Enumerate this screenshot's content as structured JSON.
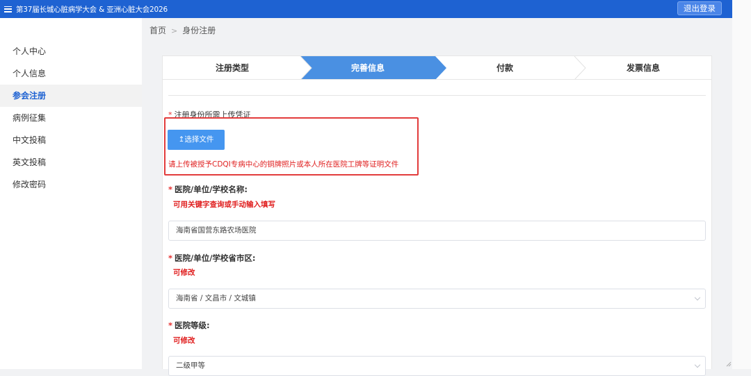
{
  "header": {
    "title": "第37届长城心脏病学大会 & 亚洲心脏大会2026",
    "logout_label": "退出登录"
  },
  "sidebar": {
    "items": [
      {
        "label": "个人中心"
      },
      {
        "label": "个人信息"
      },
      {
        "label": "参会注册",
        "active": true
      },
      {
        "label": "病例征集"
      },
      {
        "label": "中文投稿"
      },
      {
        "label": "英文投稿"
      },
      {
        "label": "修改密码"
      }
    ]
  },
  "breadcrumb": {
    "home": "首页",
    "separator": ">",
    "current": "身份注册"
  },
  "steps": [
    {
      "label": "注册类型"
    },
    {
      "label": "完善信息",
      "active": true
    },
    {
      "label": "付款"
    },
    {
      "label": "发票信息"
    }
  ],
  "form": {
    "upload": {
      "label": "注册身份所需上传凭证",
      "button_label": "↥选择文件",
      "hint": "请上传被授予CDQI专病中心的铜牌照片或本人所在医院工牌等证明文件"
    },
    "hospital_name": {
      "label": "医院/单位/学校名称:",
      "hint": "可用关键字查询或手动输入填写",
      "value": "海南省国营东路农场医院"
    },
    "hospital_region": {
      "label": "医院/单位/学校省市区:",
      "hint": "可修改",
      "value": "海南省 / 文昌市 / 文城镇"
    },
    "hospital_level": {
      "label": "医院等级:",
      "hint": "可修改",
      "value": "二级甲等"
    }
  },
  "colors": {
    "topbar": "#1e62d2",
    "step_active": "#4a90e2",
    "required": "#e63030",
    "highlight_border": "#e23b3b"
  }
}
